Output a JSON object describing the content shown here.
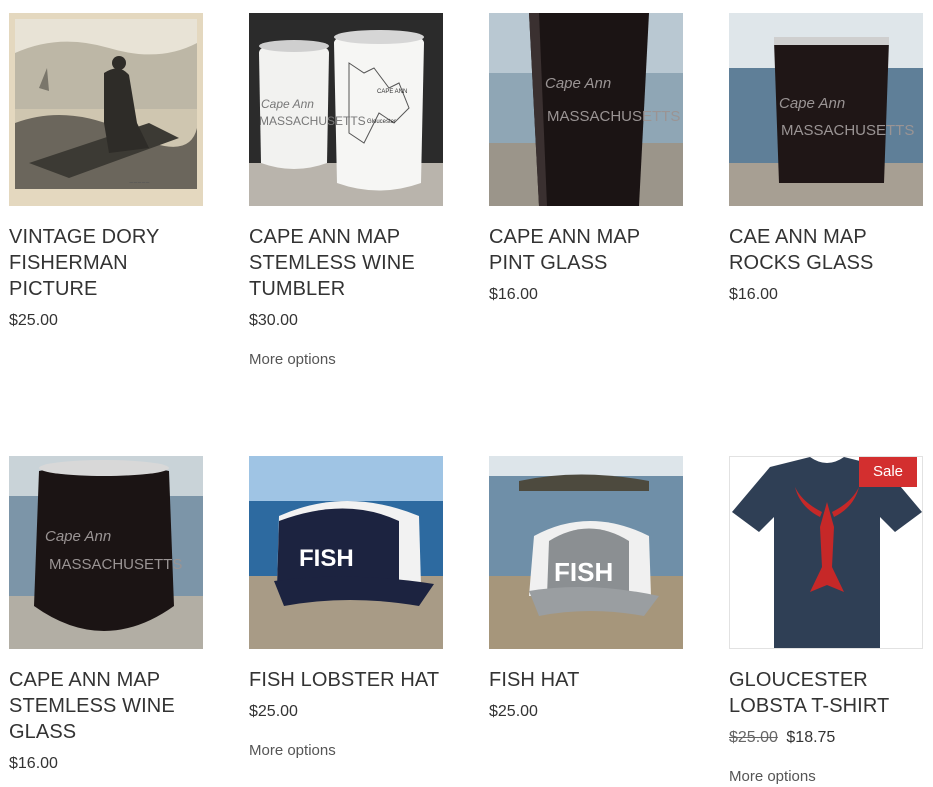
{
  "products": [
    {
      "title_lines": [
        "VINTAGE DORY",
        "FISHERMAN",
        "PICTURE"
      ],
      "price": "$25.00",
      "image": "vintage-dory-fisherman-picture"
    },
    {
      "title_lines": [
        "CAPE ANN MAP",
        "STEMLESS WINE",
        "TUMBLER"
      ],
      "price": "$30.00",
      "more": "More options",
      "image": "stemless-wine-tumblers"
    },
    {
      "title_lines": [
        "CAPE ANN MAP",
        "PINT GLASS"
      ],
      "price": "$16.00",
      "image": "pint-glass"
    },
    {
      "title_lines": [
        "CAE ANN MAP",
        "ROCKS GLASS"
      ],
      "price": "$16.00",
      "image": "rocks-glass"
    },
    {
      "title_lines": [
        "CAPE ANN MAP",
        "STEMLESS WINE",
        "GLASS"
      ],
      "price": "$16.00",
      "image": "stemless-wine-glass"
    },
    {
      "title_lines": [
        "FISH LOBSTER HAT"
      ],
      "price": "$25.00",
      "more": "More options",
      "image": "fish-lobster-hat"
    },
    {
      "title_lines": [
        "FISH HAT"
      ],
      "price": "$25.00",
      "image": "fish-hat"
    },
    {
      "title_lines": [
        "GLOUCESTER",
        "LOBSTA T-SHIRT"
      ],
      "price_old": "$25.00",
      "price_new": "$18.75",
      "badge": "Sale",
      "more": "More options",
      "image": "lobsta-t-shirt"
    }
  ],
  "glass_text": {
    "line1": "Cape Ann",
    "line2": "MASSACHUSETTS"
  },
  "hat_text": "FISH",
  "map_text": {
    "label1": "CAPE ANN",
    "label2": "Gloucester"
  },
  "colors": {
    "sale_badge": "#d32f2f",
    "text": "#333333",
    "muted": "#555555"
  }
}
